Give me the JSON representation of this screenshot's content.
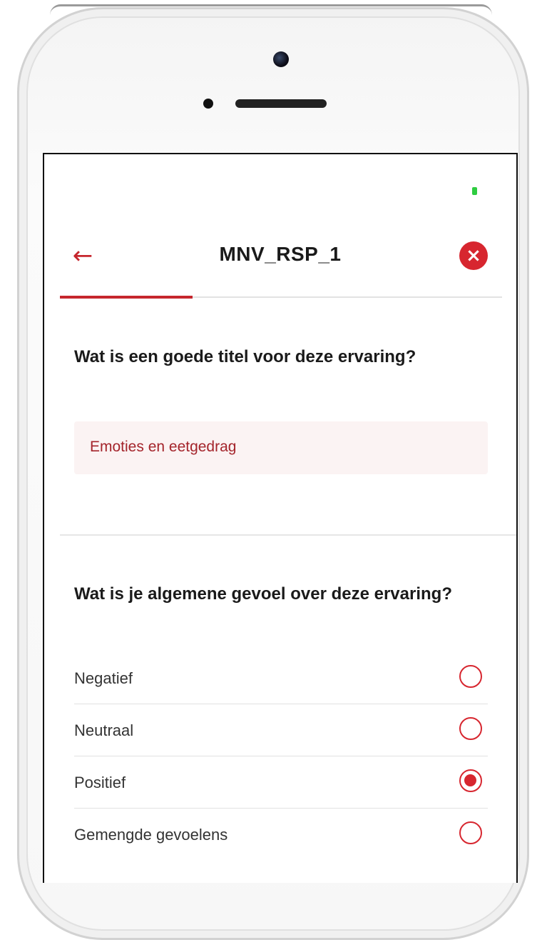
{
  "header": {
    "title": "MNV_RSP_1",
    "back_icon": "arrow-left-icon",
    "close_icon": "close-icon"
  },
  "progress": {
    "fraction": 0.3
  },
  "question1": {
    "title": "Wat is een goede titel voor deze ervaring?",
    "answer": "Emoties en eetgedrag"
  },
  "question2": {
    "title": "Wat is je algemene gevoel over deze ervaring?",
    "options": [
      {
        "label": "Negatief",
        "selected": false
      },
      {
        "label": "Neutraal",
        "selected": false
      },
      {
        "label": "Positief",
        "selected": true
      },
      {
        "label": "Gemengde gevoelens",
        "selected": false
      }
    ]
  },
  "colors": {
    "accent": "#d7262f",
    "answer_background": "#fbf3f3",
    "battery": "#2ecc40"
  }
}
